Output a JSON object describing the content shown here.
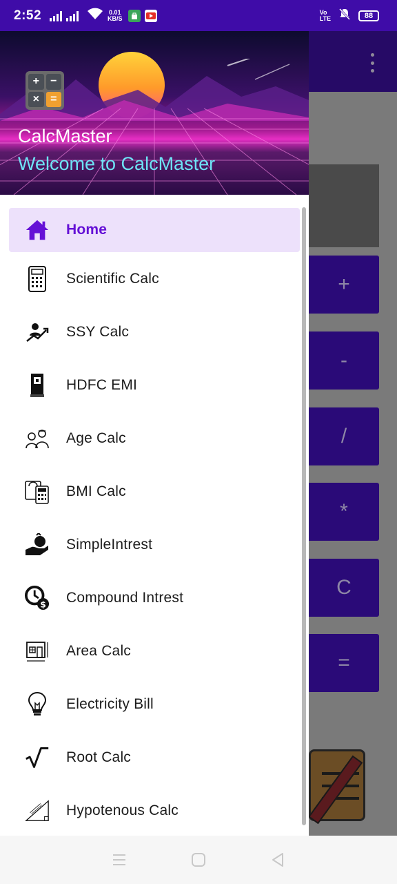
{
  "status_bar": {
    "time": "2:52",
    "net_speed_value": "0.01",
    "net_speed_unit": "KB/S",
    "volte_top": "Vo",
    "volte_bottom": "LTE",
    "battery": "88"
  },
  "drawer_header": {
    "app_title": "CalcMaster",
    "welcome_text": "Welcome to CalcMaster",
    "logo_keys": [
      "+",
      "−",
      "×",
      "="
    ]
  },
  "menu": {
    "items": [
      {
        "label": "Home",
        "icon": "home-icon",
        "active": true
      },
      {
        "label": "Scientific Calc",
        "icon": "scientific-calculator-icon"
      },
      {
        "label": "SSY Calc",
        "icon": "growth-chart-icon"
      },
      {
        "label": "HDFC EMI",
        "icon": "bank-building-icon"
      },
      {
        "label": "Age Calc",
        "icon": "people-age-icon"
      },
      {
        "label": "BMI Calc",
        "icon": "bmi-calculator-icon"
      },
      {
        "label": "SimpleIntrest",
        "icon": "hand-money-icon"
      },
      {
        "label": "Compound Intrest",
        "icon": "clock-dollar-icon"
      },
      {
        "label": "Area Calc",
        "icon": "area-plan-icon"
      },
      {
        "label": "Electricity Bill",
        "icon": "lightbulb-icon"
      },
      {
        "label": "Root Calc",
        "icon": "square-root-icon"
      },
      {
        "label": "Hypotenous Calc",
        "icon": "triangle-hypotenuse-icon"
      }
    ]
  },
  "background_app": {
    "operator_buttons": [
      "+",
      "-",
      "/",
      "*",
      "C",
      "="
    ]
  },
  "colors": {
    "status_bar": "#3f0ca8",
    "accent": "#6511d6",
    "active_item_bg": "#ede1fb",
    "welcome_text": "#6ee3f5"
  }
}
